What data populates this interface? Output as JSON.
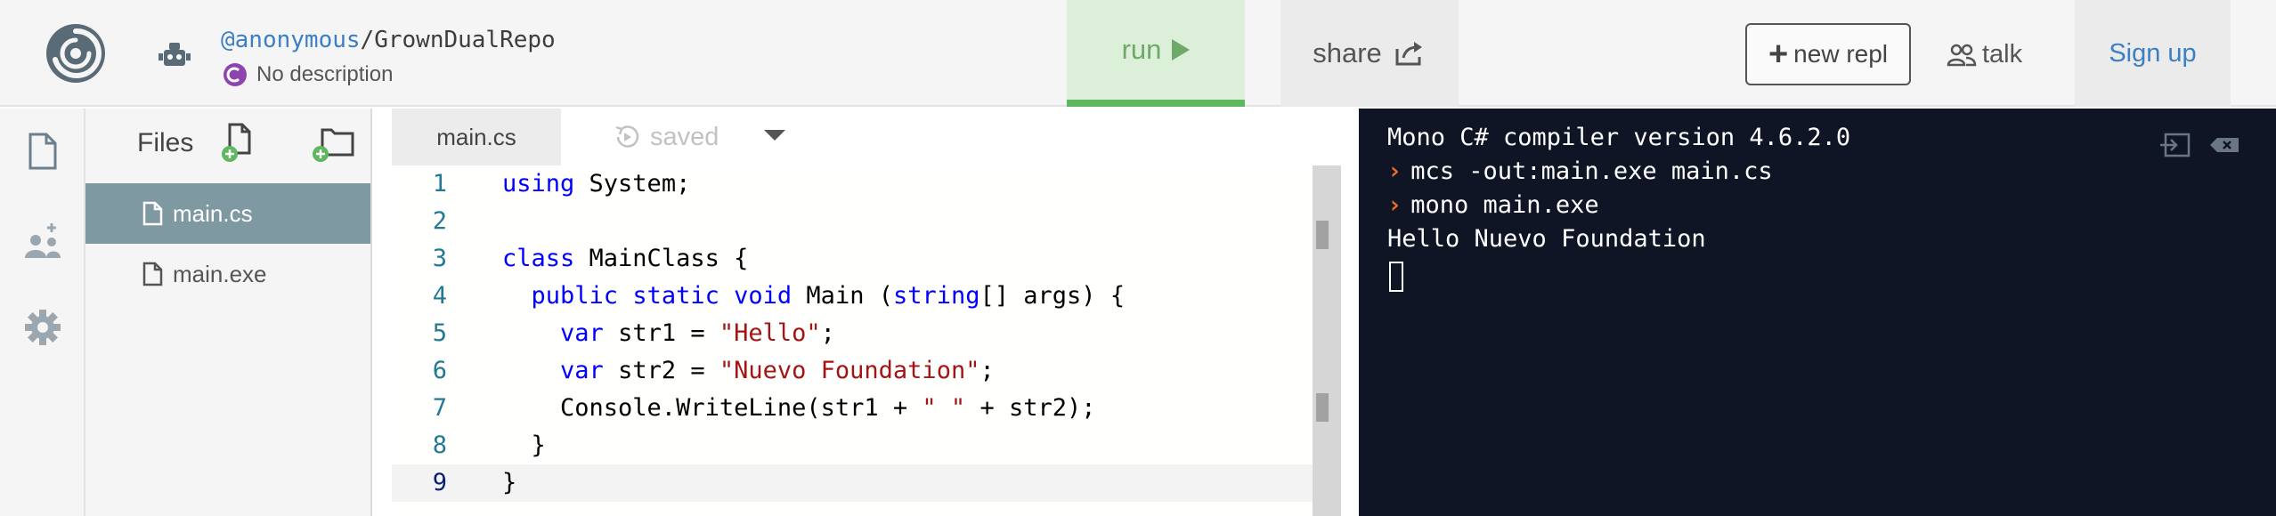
{
  "header": {
    "owner": "@anonymous",
    "separator": "/",
    "repl_name": "GrownDualRepo",
    "description": "No description",
    "run_label": "run",
    "share_label": "share",
    "new_repl_label": "new repl",
    "talk_label": "talk",
    "signup_label": "Sign up"
  },
  "files": {
    "title": "Files",
    "items": [
      {
        "name": "main.cs"
      },
      {
        "name": "main.exe"
      }
    ]
  },
  "editor": {
    "tab_label": "main.cs",
    "status": "saved",
    "lines": [
      {
        "n": "1",
        "tokens": [
          {
            "t": "using",
            "c": "kw"
          },
          {
            "t": " System;",
            "c": ""
          }
        ]
      },
      {
        "n": "2",
        "tokens": []
      },
      {
        "n": "3",
        "tokens": [
          {
            "t": "class",
            "c": "kw"
          },
          {
            "t": " MainClass {",
            "c": ""
          }
        ]
      },
      {
        "n": "4",
        "tokens": [
          {
            "t": "  ",
            "c": ""
          },
          {
            "t": "public",
            "c": "kw"
          },
          {
            "t": " ",
            "c": ""
          },
          {
            "t": "static",
            "c": "kw"
          },
          {
            "t": " ",
            "c": ""
          },
          {
            "t": "void",
            "c": "kw"
          },
          {
            "t": " Main (",
            "c": ""
          },
          {
            "t": "string",
            "c": "kw"
          },
          {
            "t": "[] args) {",
            "c": ""
          }
        ]
      },
      {
        "n": "5",
        "tokens": [
          {
            "t": "    ",
            "c": ""
          },
          {
            "t": "var",
            "c": "kw"
          },
          {
            "t": " str1 = ",
            "c": ""
          },
          {
            "t": "\"Hello\"",
            "c": "str"
          },
          {
            "t": ";",
            "c": ""
          }
        ]
      },
      {
        "n": "6",
        "tokens": [
          {
            "t": "    ",
            "c": ""
          },
          {
            "t": "var",
            "c": "kw"
          },
          {
            "t": " str2 = ",
            "c": ""
          },
          {
            "t": "\"Nuevo Foundation\"",
            "c": "str"
          },
          {
            "t": ";",
            "c": ""
          }
        ]
      },
      {
        "n": "7",
        "tokens": [
          {
            "t": "    Console.WriteLine(str1 + ",
            "c": ""
          },
          {
            "t": "\" \"",
            "c": "str"
          },
          {
            "t": " + str2);",
            "c": ""
          }
        ]
      },
      {
        "n": "8",
        "tokens": [
          {
            "t": "  }",
            "c": ""
          }
        ]
      },
      {
        "n": "9",
        "tokens": [
          {
            "t": "}",
            "c": ""
          }
        ]
      }
    ],
    "current_line": "9"
  },
  "terminal": {
    "lines": [
      {
        "text": "Mono C# compiler version 4.6.2.0",
        "prompt": false
      },
      {
        "text": "mcs -out:main.exe main.cs",
        "prompt": true
      },
      {
        "text": "mono main.exe",
        "prompt": true
      },
      {
        "text": "Hello Nuevo Foundation",
        "prompt": false
      }
    ]
  },
  "colors": {
    "run_bg": "#dcefd9",
    "run_accent": "#5fb760",
    "active_file_bg": "#7f99a3",
    "terminal_bg": "#0f1525",
    "prompt": "#f26d21",
    "link": "#3b7fc4"
  }
}
